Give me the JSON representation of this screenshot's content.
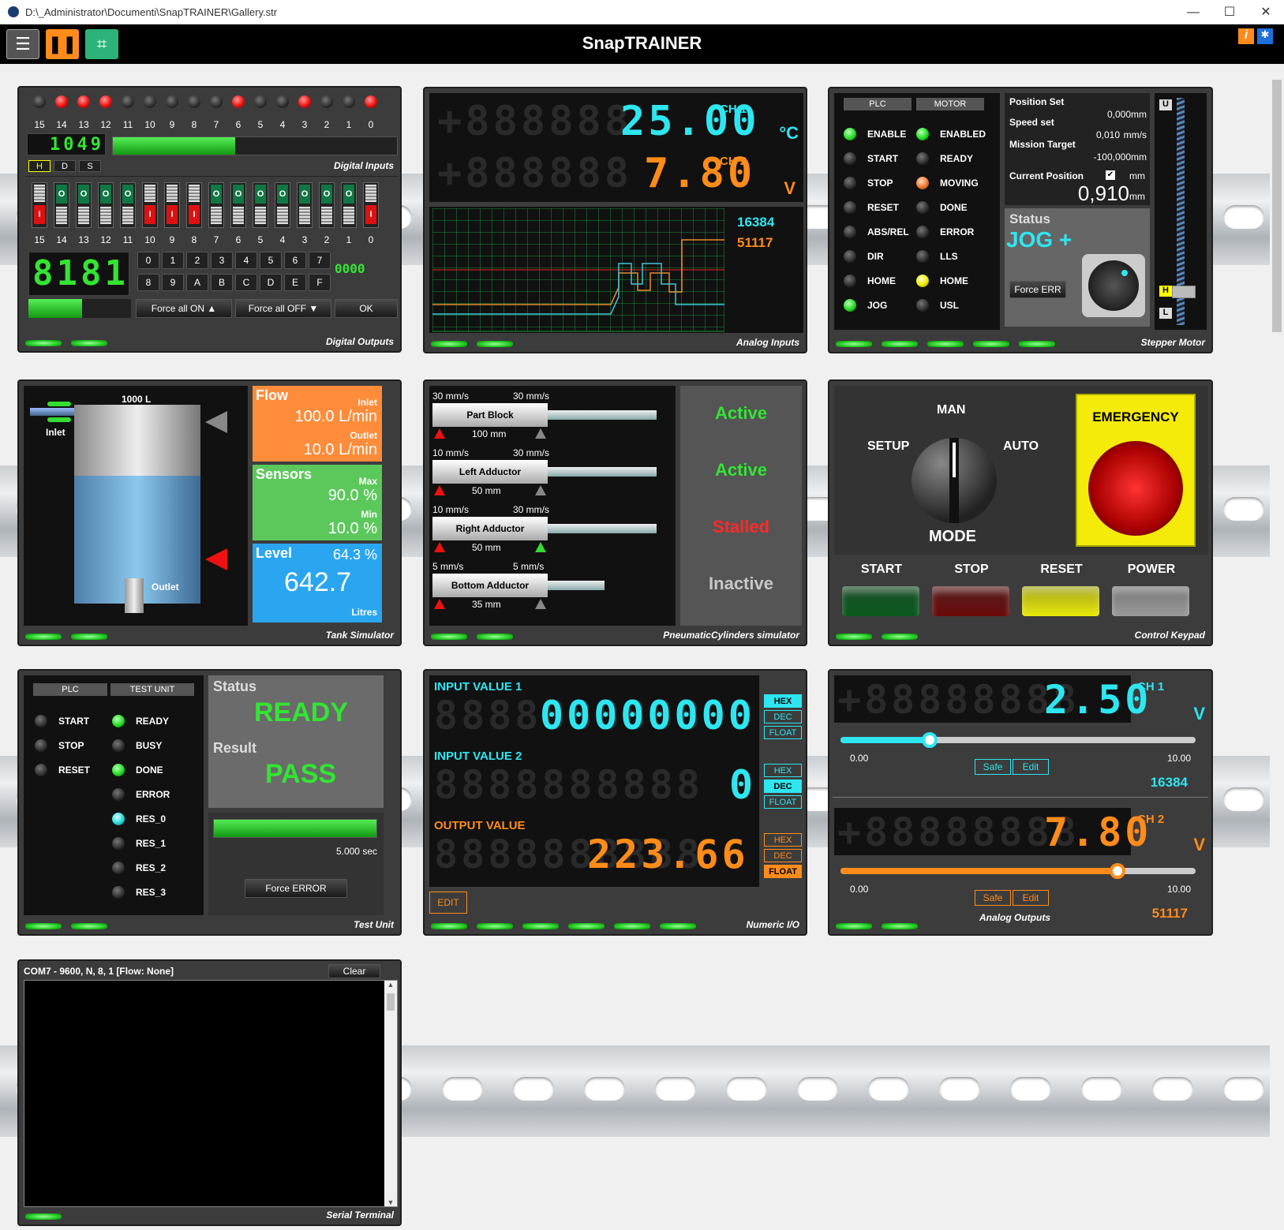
{
  "window": {
    "path": "D:\\_Administrator\\Documenti\\SnapTRAINER\\Gallery.str",
    "min": "—",
    "max": "☐",
    "close": "✕"
  },
  "app": {
    "title": "SnapTRAINER",
    "info": "i"
  },
  "digital_inputs": {
    "numbers": [
      "15",
      "14",
      "13",
      "12",
      "11",
      "10",
      "9",
      "8",
      "7",
      "6",
      "5",
      "4",
      "3",
      "2",
      "1",
      "0"
    ],
    "led_states": [
      "off",
      "on",
      "on",
      "on",
      "off",
      "off",
      "off",
      "off",
      "off",
      "on",
      "off",
      "off",
      "on",
      "off",
      "off",
      "on"
    ],
    "hex_value": "1049",
    "modes": [
      "H",
      "D",
      "S"
    ],
    "title": "Digital Inputs"
  },
  "digital_outputs": {
    "switch_states": [
      "on",
      "o",
      "o",
      "o",
      "o",
      "on",
      "on",
      "on",
      "o",
      "o",
      "o",
      "o",
      "o",
      "o",
      "o",
      "on"
    ],
    "numbers": [
      "15",
      "14",
      "13",
      "12",
      "11",
      "10",
      "9",
      "8",
      "7",
      "6",
      "5",
      "4",
      "3",
      "2",
      "1",
      "0"
    ],
    "display": "8181",
    "keys": [
      "0",
      "1",
      "2",
      "3",
      "4",
      "5",
      "6",
      "7",
      "8",
      "9",
      "A",
      "B",
      "C",
      "D",
      "E",
      "F"
    ],
    "value": "0000",
    "force_on": "Force all ON",
    "force_off": "Force all OFF",
    "ok": "OK",
    "title": "Digital Outputs",
    "switch_on": "I",
    "switch_off": "O"
  },
  "analog_inputs": {
    "ch1_value": "25.00",
    "ch1_label": "CH 1",
    "ch1_unit": "°C",
    "ch2_value": "7.80",
    "ch2_label": "CH 2",
    "ch2_unit": "V",
    "raw1": "16384",
    "raw2": "51117",
    "title": "Analog Inputs"
  },
  "stepper": {
    "plc_header": "PLC",
    "motor_header": "MOTOR",
    "plc_rows": [
      {
        "label": "ENABLE",
        "state": "green"
      },
      {
        "label": "START",
        "state": "off"
      },
      {
        "label": "STOP",
        "state": "off"
      },
      {
        "label": "RESET",
        "state": "off"
      },
      {
        "label": "ABS/REL",
        "state": "off"
      },
      {
        "label": "DIR",
        "state": "off"
      },
      {
        "label": "HOME",
        "state": "off"
      },
      {
        "label": "JOG",
        "state": "green"
      }
    ],
    "motor_rows": [
      {
        "label": "ENABLED",
        "state": "green"
      },
      {
        "label": "READY",
        "state": "off"
      },
      {
        "label": "MOVING",
        "state": "orange"
      },
      {
        "label": "DONE",
        "state": "off"
      },
      {
        "label": "ERROR",
        "state": "off"
      },
      {
        "label": "LLS",
        "state": "off"
      },
      {
        "label": "HOME",
        "state": "yellow"
      },
      {
        "label": "USL",
        "state": "off"
      }
    ],
    "position_set_label": "Position Set",
    "position_set": "0,000",
    "speed_set_label": "Speed set",
    "speed_set": "0,010",
    "speed_unit": "mm/s",
    "mission_target_label": "Mission Target",
    "mission_target": "-100,000",
    "current_position_label": "Current Position",
    "current_position": "0,910",
    "mm": "mm",
    "status_label": "Status",
    "status_value": "JOG +",
    "force_err": "Force ERR",
    "u": "U",
    "h": "H",
    "l": "L",
    "title": "Stepper Motor"
  },
  "tank": {
    "capacity": "1000 L",
    "inlet": "Inlet",
    "outlet": "Outlet",
    "flow_label": "Flow",
    "inlet_label": "Inlet",
    "inlet_flow": "100.0 L/min",
    "outlet_label": "Outlet",
    "outlet_flow": "10.0 L/min",
    "sensors_label": "Sensors",
    "max_label": "Max",
    "max": "90.0 %",
    "min_label": "Min",
    "min": "10.0 %",
    "level_label": "Level",
    "level_pct": "64.3 %",
    "level_value": "642.7",
    "litres": "Litres",
    "title": "Tank Simulator",
    "level_fraction": 0.643
  },
  "pneumatic": {
    "cylinders": [
      {
        "name": "Part Block",
        "left": "30 mm/s",
        "right": "30 mm/s",
        "stroke": "100 mm",
        "status": "Active",
        "status_color": "#33e533"
      },
      {
        "name": "Left Adductor",
        "left": "10 mm/s",
        "right": "30 mm/s",
        "stroke": "50 mm",
        "status": "Active",
        "status_color": "#33e533"
      },
      {
        "name": "Right Adductor",
        "left": "10 mm/s",
        "right": "30 mm/s",
        "stroke": "50 mm",
        "status": "Stalled",
        "status_color": "#ff2a2a"
      },
      {
        "name": "Bottom Adductor",
        "left": "5 mm/s",
        "right": "5 mm/s",
        "stroke": "35 mm",
        "status": "Inactive",
        "status_color": "#c8c8c8"
      }
    ],
    "title": "PneumaticCylinders simulator"
  },
  "keypad": {
    "man": "MAN",
    "setup": "SETUP",
    "auto": "AUTO",
    "mode": "MODE",
    "emergency": "EMERGENCY",
    "buttons": [
      "START",
      "STOP",
      "RESET",
      "POWER"
    ],
    "title": "Control Keypad"
  },
  "test_unit": {
    "plc_header": "PLC",
    "unit_header": "TEST UNIT",
    "plc_rows": [
      "START",
      "STOP",
      "RESET"
    ],
    "unit_rows": [
      {
        "label": "READY",
        "state": "green"
      },
      {
        "label": "BUSY",
        "state": "off"
      },
      {
        "label": "DONE",
        "state": "green"
      },
      {
        "label": "ERROR",
        "state": "off"
      },
      {
        "label": "RES_0",
        "state": "cyan"
      },
      {
        "label": "RES_1",
        "state": "off"
      },
      {
        "label": "RES_2",
        "state": "off"
      },
      {
        "label": "RES_3",
        "state": "off"
      }
    ],
    "status_label": "Status",
    "status_value": "READY",
    "result_label": "Result",
    "result_value": "PASS",
    "time": "5.000 sec",
    "force_error": "Force ERROR",
    "title": "Test Unit",
    "progress": 1.0
  },
  "numeric_io": {
    "in1_label": "INPUT VALUE 1",
    "in1_value": "00000000",
    "in2_label": "INPUT VALUE 2",
    "in2_value": "0",
    "out_label": "OUTPUT VALUE",
    "out_value": "223.66",
    "hex": "HEX",
    "dec": "DEC",
    "float": "FLOAT",
    "edit": "EDIT",
    "title": "Numeric I/O"
  },
  "analog_outputs": {
    "ch1_value": "2.50",
    "ch1_label": "CH 1",
    "ch1_unit": "V",
    "ch1_min": "0.00",
    "ch1_max": "10.00",
    "ch1_raw": "16384",
    "ch1_fraction": 0.25,
    "ch2_value": "7.80",
    "ch2_label": "CH 2",
    "ch2_unit": "V",
    "ch2_min": "0.00",
    "ch2_max": "10.00",
    "ch2_raw": "51117",
    "ch2_fraction": 0.78,
    "safe": "Safe",
    "edit": "Edit",
    "title": "Analog Outputs"
  },
  "serial": {
    "port": "COM7 - 9600, N, 8, 1 [Flow: None]",
    "clear": "Clear",
    "title": "Serial Terminal"
  },
  "colors": {
    "cyan": "#2ee6f0",
    "orange": "#ff8c1a",
    "green": "#33e533",
    "panel": "#3c3c3c"
  }
}
